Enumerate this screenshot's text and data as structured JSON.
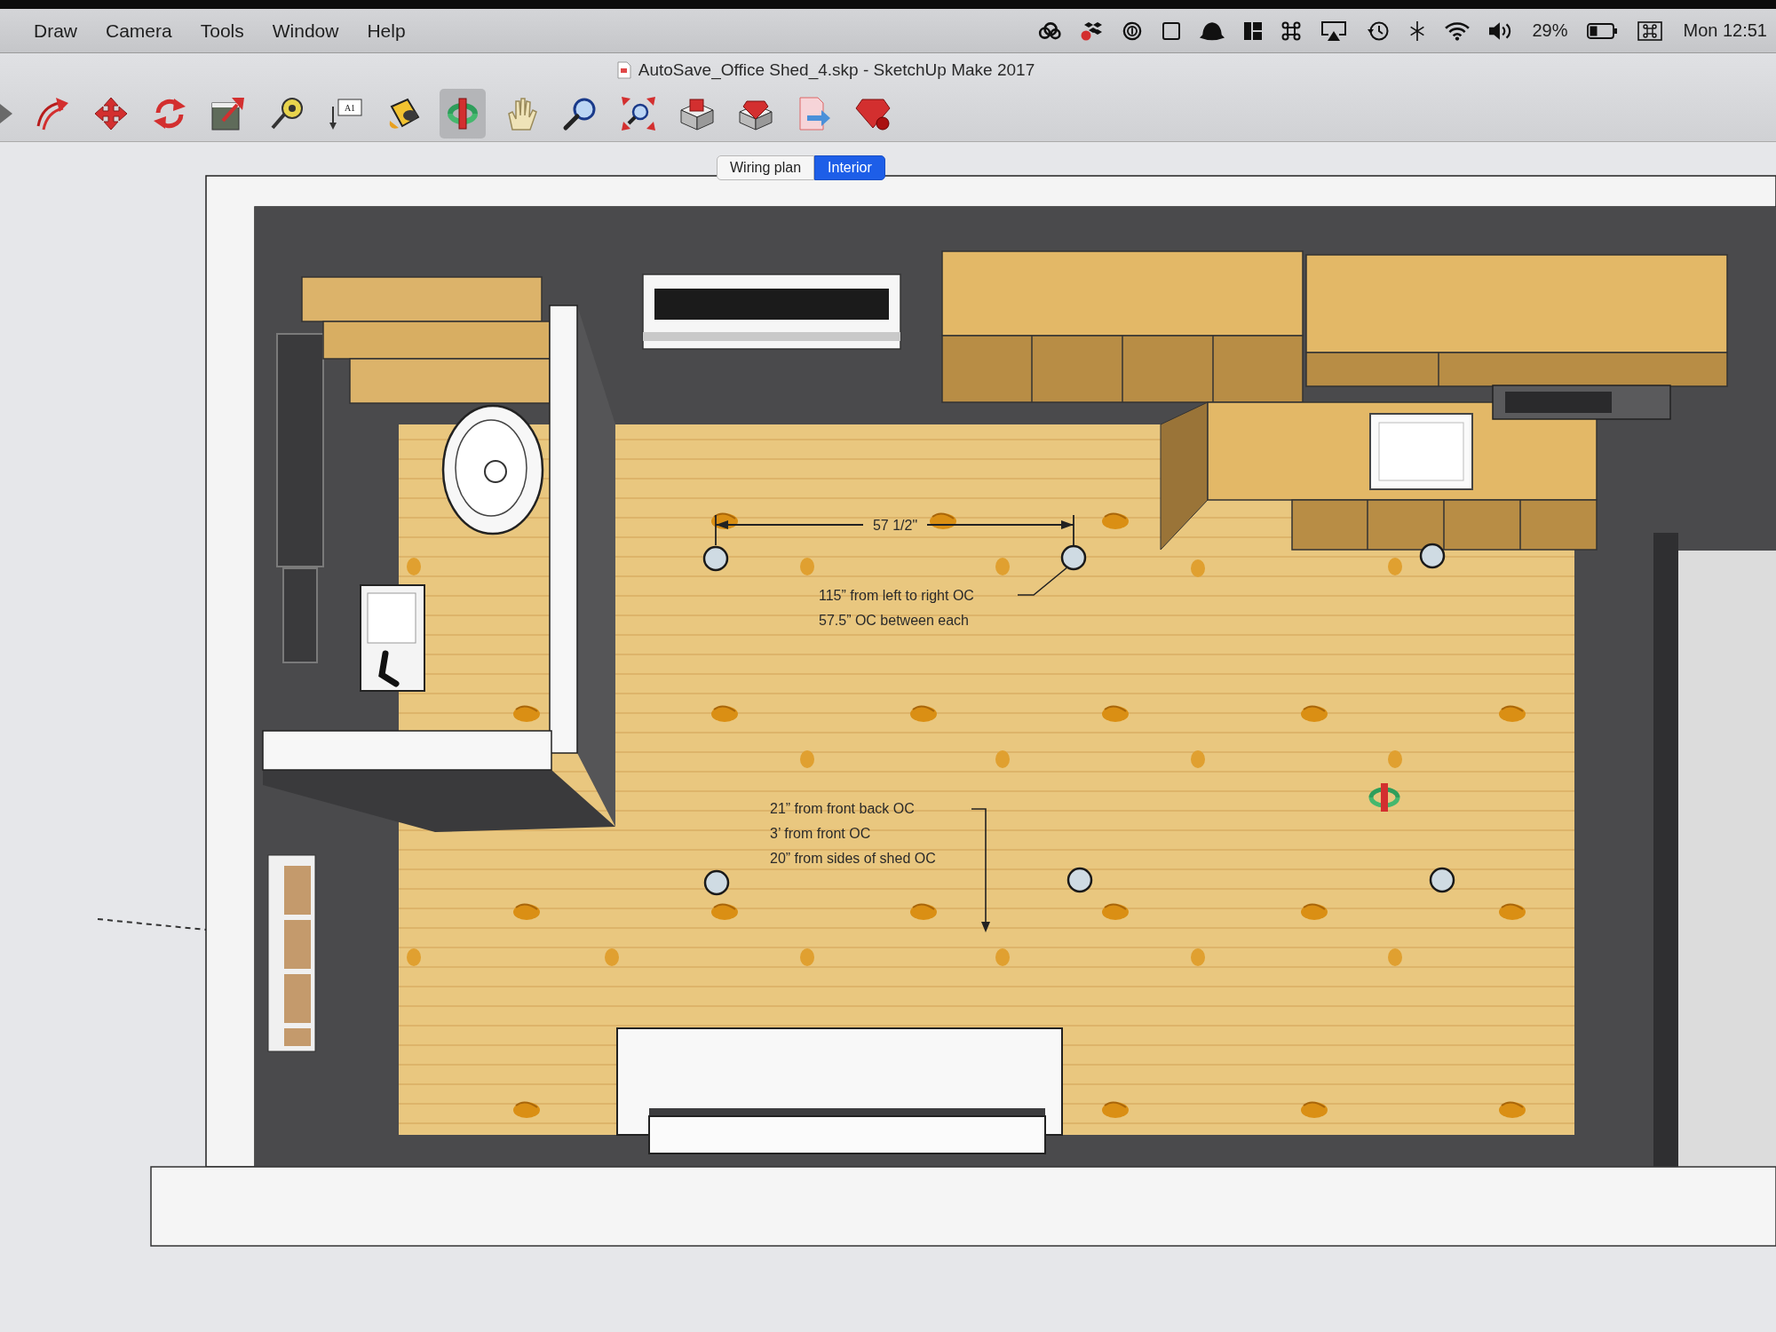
{
  "menu_bar": {
    "menus": [
      "Draw",
      "Camera",
      "Tools",
      "Window",
      "Help"
    ],
    "battery": "29%",
    "clock": "Mon 12:51"
  },
  "window": {
    "title": "AutoSave_Office Shed_4.skp - SketchUp Make 2017"
  },
  "toolbar": {
    "tools": [
      {
        "kind": "select",
        "selected": false
      },
      {
        "kind": "follow",
        "selected": false
      },
      {
        "kind": "move",
        "selected": false
      },
      {
        "kind": "rotate",
        "selected": false
      },
      {
        "kind": "scale",
        "selected": false
      },
      {
        "kind": "tape",
        "selected": false
      },
      {
        "kind": "text",
        "label": "A1",
        "selected": false
      },
      {
        "kind": "paint",
        "selected": false
      },
      {
        "kind": "orbit",
        "selected": true
      },
      {
        "kind": "pan",
        "selected": false
      },
      {
        "kind": "zoom",
        "selected": false
      },
      {
        "kind": "zoom_extents",
        "selected": false
      },
      {
        "kind": "warehouse",
        "selected": false
      },
      {
        "kind": "extension",
        "selected": false
      },
      {
        "kind": "layout",
        "selected": false
      },
      {
        "kind": "ruby",
        "selected": false
      }
    ]
  },
  "scene_tabs": [
    {
      "label": "Wiring plan",
      "selected": false
    },
    {
      "label": "Interior",
      "selected": true
    }
  ],
  "model": {
    "dimension": "57 1/2\"",
    "notes": [
      {
        "lines": [
          "115” from left to right OC",
          "57.5” OC between each"
        ]
      },
      {
        "lines": [
          "21” from front back OC",
          "3’ from front OC",
          "20” from sides of shed OC"
        ]
      }
    ]
  }
}
